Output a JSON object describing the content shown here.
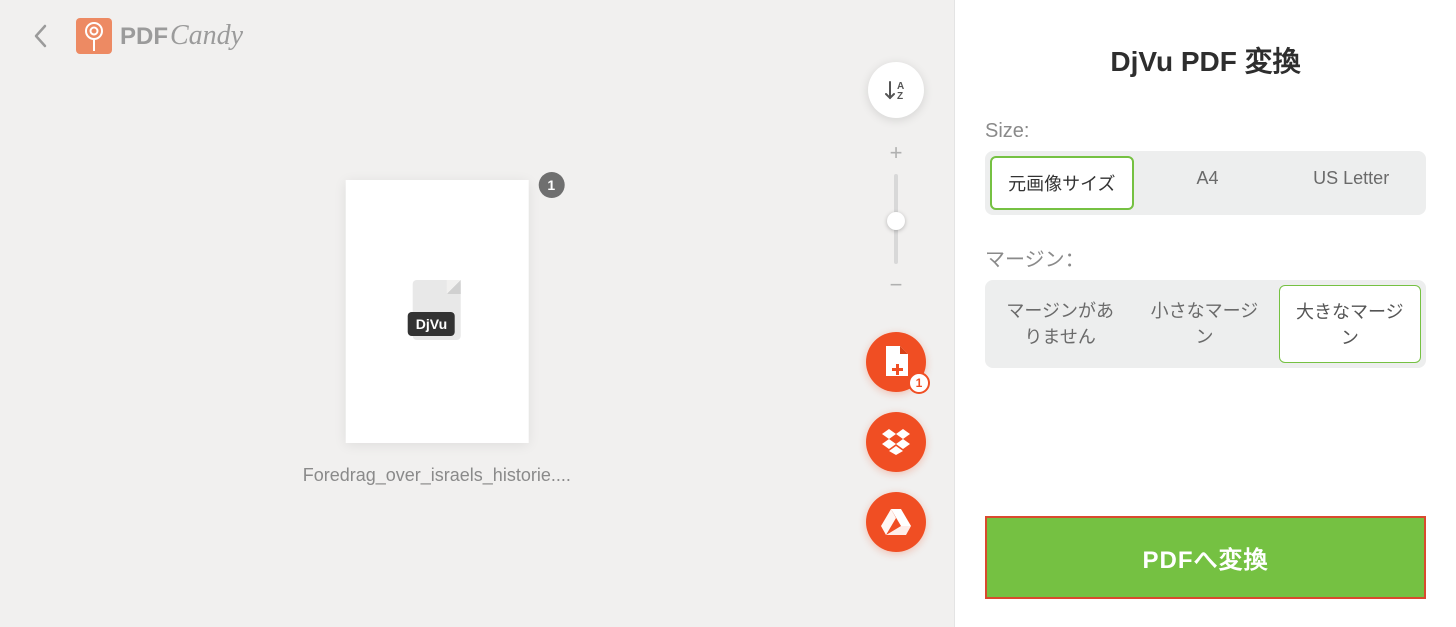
{
  "logo": {
    "pdf_text": "PDF",
    "candy_text": "Candy"
  },
  "file": {
    "badge_label": "DjVu",
    "index": "1",
    "name": "Foredrag_over_israels_historie...."
  },
  "tools": {
    "add_count": "1"
  },
  "panel": {
    "title": "DjVu PDF 変換",
    "size_label": "Size:",
    "size_options": {
      "original": "元画像サイズ",
      "a4": "A4",
      "usletter": "US Letter"
    },
    "margin_label": "マージン：",
    "margin_options": {
      "none": "マージンがありません",
      "small": "小さなマージン",
      "large": "大きなマージン"
    },
    "convert_label": "PDFへ変換"
  }
}
